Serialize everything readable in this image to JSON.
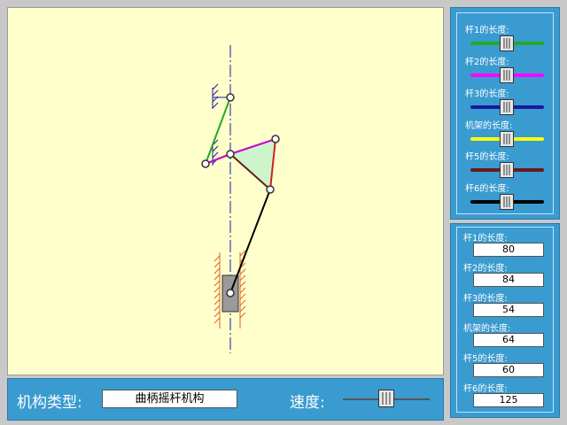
{
  "controls": {
    "mechanism_type_label": "机构类型:",
    "mechanism_type_value": "曲柄摇杆机构",
    "speed_label": "速度:"
  },
  "length_sliders": [
    {
      "label": "杆1的长度:",
      "color": "#22aa22"
    },
    {
      "label": "杆2的长度:",
      "color": "#ff00ff"
    },
    {
      "label": "杆3的长度:",
      "color": "#1a1aa0"
    },
    {
      "label": "机架的长度:",
      "color": "#ffff00"
    },
    {
      "label": "杆5的长度:",
      "color": "#6b1a1a"
    },
    {
      "label": "杆6的长度:",
      "color": "#000000"
    }
  ],
  "length_values": [
    {
      "label": "杆1的长度:",
      "value": "80"
    },
    {
      "label": "杆2的长度:",
      "value": "84"
    },
    {
      "label": "杆3的长度:",
      "value": "54"
    },
    {
      "label": "机架的长度:",
      "value": "64"
    },
    {
      "label": "杆5的长度:",
      "value": "60"
    },
    {
      "label": "杆6的长度:",
      "value": "125"
    }
  ],
  "colors": {
    "canvas_bg": "#ffffcc",
    "panel_bg": "#3a9bd0",
    "link1": "#22aa22",
    "link2": "#cc00cc",
    "link3": "#1a1aa0",
    "link5": "#cc2222",
    "link6": "#000000",
    "coupler_fill": "#ccf5cc"
  }
}
